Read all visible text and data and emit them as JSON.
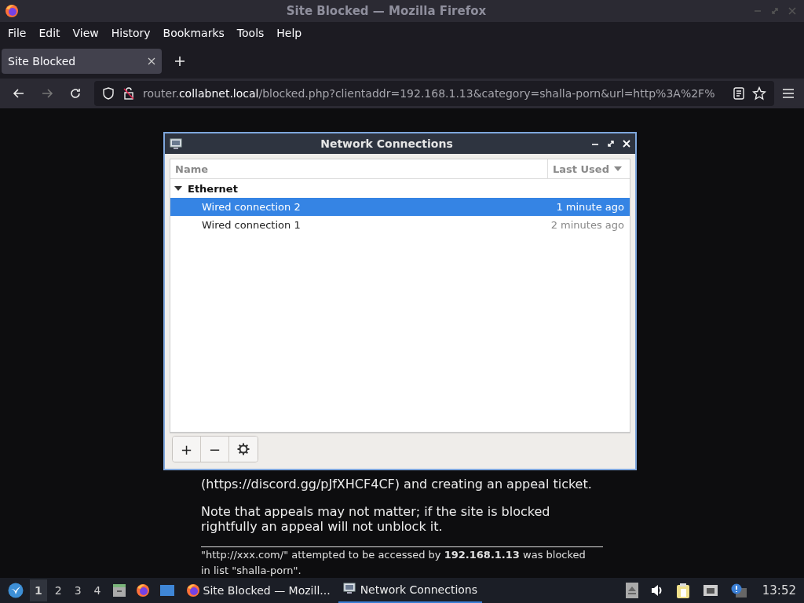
{
  "window": {
    "title": "Site Blocked — Mozilla Firefox"
  },
  "menu": [
    "File",
    "Edit",
    "View",
    "History",
    "Bookmarks",
    "Tools",
    "Help"
  ],
  "tabs": [
    {
      "label": "Site Blocked",
      "selected": true
    }
  ],
  "address": {
    "prefix": "router.",
    "host": "collabnet.local",
    "rest": "/blocked.php?clientaddr=192.168.1.13&category=shalla-porn&url=http%3A%2F%"
  },
  "page": {
    "paragraphs": [
      "(https://discord.gg/pJfXHCF4CF) and creating an appeal ticket.",
      "Note that appeals may not matter; if the site is blocked rightfully an appeal will not unblock it."
    ],
    "footer": "\"http://xxx.com/\" attempted to be accessed by **192.168.1.13** was blocked in list \"shalla-porn\"."
  },
  "dialog": {
    "title": "Network Connections",
    "columns": [
      "Name",
      "Last Used"
    ],
    "groups": [
      {
        "name": "Ethernet",
        "expanded": true,
        "children": [
          {
            "name": "Wired connection 2",
            "last_used": "1 minute ago",
            "selected": true
          },
          {
            "name": "Wired connection 1",
            "last_used": "2 minutes ago",
            "selected": false
          }
        ]
      }
    ],
    "buttons": [
      "+",
      "−"
    ]
  },
  "taskbar": {
    "workspaces": [
      {
        "label": "1",
        "selected": true
      },
      {
        "label": "2",
        "selected": false
      },
      {
        "label": "3",
        "selected": false
      },
      {
        "label": "4",
        "selected": false
      }
    ],
    "tasks": [
      {
        "label": "Site Blocked — Mozill...",
        "kind": "browser",
        "selected": false
      },
      {
        "label": "Network Connections",
        "kind": "network",
        "selected": true
      }
    ],
    "clock": "13:52"
  }
}
